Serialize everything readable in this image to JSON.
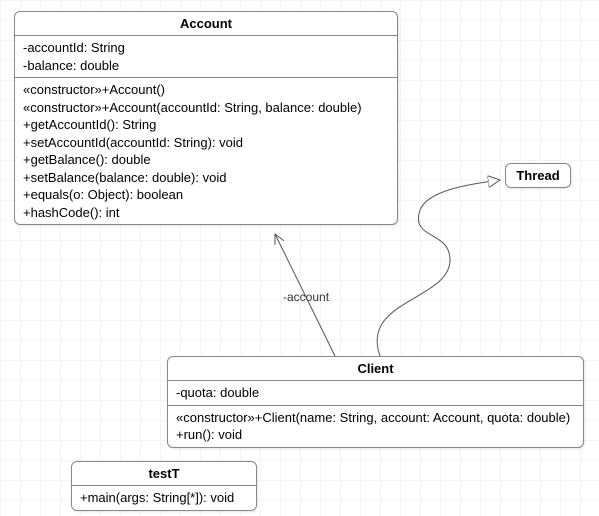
{
  "chart_data": {
    "type": "uml_class_diagram",
    "classes": [
      {
        "id": "Account",
        "name": "Account",
        "attributes": [
          "-accountId: String",
          "-balance: double"
        ],
        "operations": [
          "«constructor»+Account()",
          "«constructor»+Account(accountId: String, balance: double)",
          "+getAccountId(): String",
          "+setAccountId(accountId: String): void",
          "+getBalance(): double",
          "+setBalance(balance: double): void",
          "+equals(o: Object): boolean",
          "+hashCode(): int"
        ]
      },
      {
        "id": "Thread",
        "name": "Thread",
        "attributes": [],
        "operations": []
      },
      {
        "id": "Client",
        "name": "Client",
        "attributes": [
          "-quota: double"
        ],
        "operations": [
          "«constructor»+Client(name: String, account: Account, quota: double)",
          "+run(): void"
        ]
      },
      {
        "id": "testT",
        "name": "testT",
        "attributes": [],
        "operations": [
          "+main(args: String[*]): void"
        ]
      }
    ],
    "relationships": [
      {
        "from": "Client",
        "to": "Account",
        "type": "association",
        "label": "-account"
      },
      {
        "from": "Client",
        "to": "Thread",
        "type": "generalization"
      }
    ]
  },
  "classes": {
    "account": {
      "title": "Account",
      "attrs": {
        "a0": "-accountId: String",
        "a1": "-balance: double"
      },
      "ops": {
        "o0": "«constructor»+Account()",
        "o1": "«constructor»+Account(accountId: String, balance: double)",
        "o2": "+getAccountId(): String",
        "o3": "+setAccountId(accountId: String): void",
        "o4": "+getBalance(): double",
        "o5": "+setBalance(balance: double): void",
        "o6": "+equals(o: Object): boolean",
        "o7": "+hashCode(): int"
      }
    },
    "thread": {
      "title": "Thread"
    },
    "client": {
      "title": "Client",
      "attrs": {
        "a0": "-quota: double"
      },
      "ops": {
        "o0": "«constructor»+Client(name: String, account: Account, quota: double)",
        "o1": "+run(): void"
      }
    },
    "testt": {
      "title": "testT",
      "ops": {
        "o0": "+main(args: String[*]): void"
      }
    }
  },
  "labels": {
    "account_assoc": "-account"
  }
}
